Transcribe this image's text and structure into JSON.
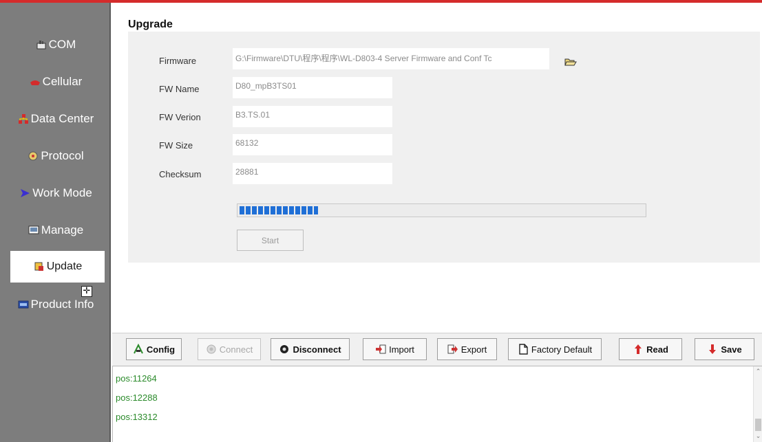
{
  "sidebar": {
    "items": [
      {
        "label": "COM",
        "icon": "com-port-icon"
      },
      {
        "label": "Cellular",
        "icon": "phone-icon"
      },
      {
        "label": "Data Center",
        "icon": "network-icon"
      },
      {
        "label": "Protocol",
        "icon": "protocol-icon"
      },
      {
        "label": "Work Mode",
        "icon": "arrow-right-icon"
      },
      {
        "label": "Manage",
        "icon": "manage-icon"
      },
      {
        "label": "Update",
        "icon": "update-icon"
      },
      {
        "label": "Product Info",
        "icon": "product-info-icon"
      }
    ],
    "active_index": 6
  },
  "upgrade": {
    "title": "Upgrade",
    "fields": {
      "firmware": {
        "label": "Firmware",
        "value": "G:\\Firmware\\DTU\\程序\\程序\\WL-D803-4 Server Firmware and Conf Tc"
      },
      "fw_name": {
        "label": "FW Name",
        "value": "D80_mpB3TS01"
      },
      "fw_version": {
        "label": "FW Verion",
        "value": "B3.TS.01"
      },
      "fw_size": {
        "label": "FW Size",
        "value": "68132"
      },
      "checksum": {
        "label": "Checksum",
        "value": "28881"
      }
    },
    "progress_fraction": 0.195,
    "start_label": "Start"
  },
  "toolbar": {
    "config": "Config",
    "connect": "Connect",
    "disconnect": "Disconnect",
    "import": "Import",
    "export": "Export",
    "factory_default": "Factory Default",
    "read": "Read",
    "save": "Save"
  },
  "log": {
    "lines": [
      "pos:11264",
      "pos:12288",
      "pos:13312"
    ]
  },
  "colors": {
    "sidebar_bg": "#7d7d7d",
    "accent_red": "#d42b2b",
    "progress_blue": "#1f6fd6",
    "log_green": "#2a8a2a"
  }
}
